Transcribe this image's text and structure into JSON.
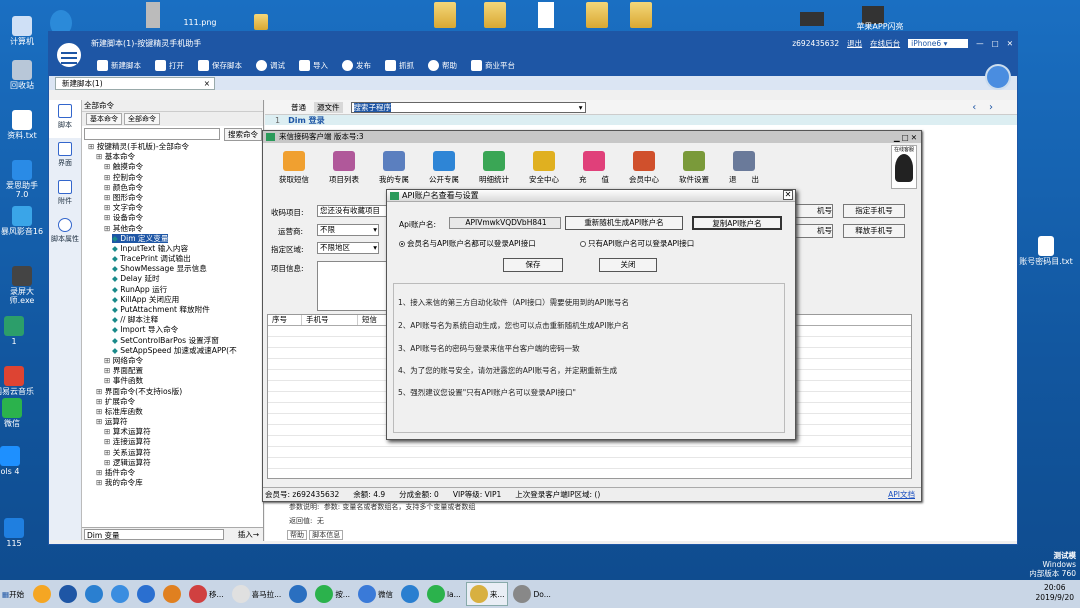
{
  "desktop": {
    "left_icons": [
      "计算机",
      "回收站",
      "资料.txt",
      "爱思助手7.0",
      "暴风影音16",
      "录屏大师.exe",
      "1",
      "音乐",
      "网易云音乐",
      "微信",
      "ols 4",
      "连接",
      "C#5",
      "115",
      "精灵手.exe"
    ],
    "top_icons": [
      "111.png",
      "抖音版本使用",
      "微信视频",
      "分享GO群",
      "苹果APP闪亮"
    ],
    "right_icons": [
      "账号密码目.txt"
    ],
    "watermark": [
      "测试模",
      "Windows",
      "内部版本 760"
    ]
  },
  "main": {
    "title": "新建脚本(1)-按键精灵手机助手",
    "user": "z692435632",
    "links": [
      "退出",
      "在线后台"
    ],
    "device": "iPhone6",
    "toolbar": [
      "新建脚本",
      "打开",
      "保存脚本",
      "调试",
      "导入",
      "发布",
      "抓抓",
      "帮助",
      "商业平台"
    ],
    "tab": "新建脚本(1)",
    "left_nav": [
      "脚本",
      "界面",
      "附件",
      "脚本属性"
    ],
    "tree_header": "全部命令",
    "tree_tabs": [
      "基本命令",
      "全部命令"
    ],
    "search_btn": "搜索命令",
    "tree": [
      "按键精灵(手机版)-全部命令",
      "基本命令",
      "触摸命令",
      "控制命令",
      "颜色命令",
      "图形命令",
      "文字命令",
      "设备命令",
      "其他命令",
      "Dim 定义变量",
      "InputText 输入内容",
      "TracePrint 调试输出",
      "ShowMessage 显示信息",
      "Delay 延时",
      "RunApp 运行",
      "KillApp 关闭应用",
      "PutAttachment 释放附件",
      "// 脚本注释",
      "Import 导入命令",
      "SetControlBarPos 设置浮窗",
      "SetAppSpeed 加速或减速APP(不",
      "网络命令",
      "界面配置",
      "事件函数",
      "界面命令(不支持ios版)",
      "扩展命令",
      "标准库函数",
      "运算符",
      "算术运算符",
      "连接运算符",
      "关系运算符",
      "逻辑运算符",
      "插件命令",
      "我的命令库"
    ],
    "tree_bottom": "Dim 变量",
    "insert_btn": "插入→",
    "editor_tabs": [
      "普通",
      "源文件"
    ],
    "editor_select": "搜索子程序",
    "line_no": "1",
    "code": "Dim 登录",
    "bottom_labels": [
      "参数说明:",
      "参数: 变量名或者数组名，支持多个变量或者数组",
      "返回值:",
      "无",
      "帮助",
      "脚本信息"
    ]
  },
  "client": {
    "title": "来信接码客户端 版本号:3",
    "toolbar": [
      "获取短信",
      "项目列表",
      "我的专属",
      "公开专属",
      "明细统计",
      "安全中心",
      "充　　值",
      "会员中心",
      "软件设置",
      "退　　出"
    ],
    "form": {
      "project_label": "收码项目:",
      "project_value": "您还没有收藏项目",
      "carrier_label": "运营商:",
      "carrier_value": "不限",
      "region_label": "指定区域:",
      "region_value": "不限地区",
      "info_label": "项目信息:"
    },
    "right_btns": [
      "指定手机号",
      "释放手机号",
      "申号",
      "黑号"
    ],
    "qq": "在线客服",
    "grid_cols": [
      "序号",
      "手机号",
      "短信"
    ],
    "status": [
      "会员号: z692435632",
      "余额: 4.9",
      "分成金额: 0",
      "VIP等级: VIP1",
      "上次登录客户端IP区域: ()",
      "API文档"
    ]
  },
  "dialog": {
    "title": "API账户名查看与设置",
    "name_label": "Api账户名:",
    "name_value": "APIVmwkVQDVbH841",
    "btn_regen": "重新随机生成API账户名",
    "btn_copy": "复制API账户名",
    "radio1": "会员名与API账户名都可以登录API接口",
    "radio2": "只有API账户名可以登录API接口",
    "save": "保存",
    "close": "关闭",
    "info": [
      "1、接入来信的第三方自动化软件（API接口）需要使用到的API账号名",
      "2、API账号名为系统自动生成，您也可以点击重新随机生成API账户名",
      "3、API账号名的密码与登录来信平台客户端的密码一致",
      "4、为了您的账号安全，请勿泄露您的API账号名，并定期重新生成",
      "5、强烈建议您设置\"只有API账户名可以登录API接口\""
    ]
  },
  "taskbar": {
    "start": "开始",
    "items": [
      "",
      "",
      "",
      "",
      "",
      "",
      "移...",
      "喜马拉...",
      "",
      "按...",
      "微信",
      "",
      "la...",
      "来...",
      "Do...",
      ""
    ],
    "time": "20:06",
    "date": "2019/9/20"
  },
  "colors": {
    "accent": "#1e56a5",
    "desktop": "#1560a8"
  }
}
